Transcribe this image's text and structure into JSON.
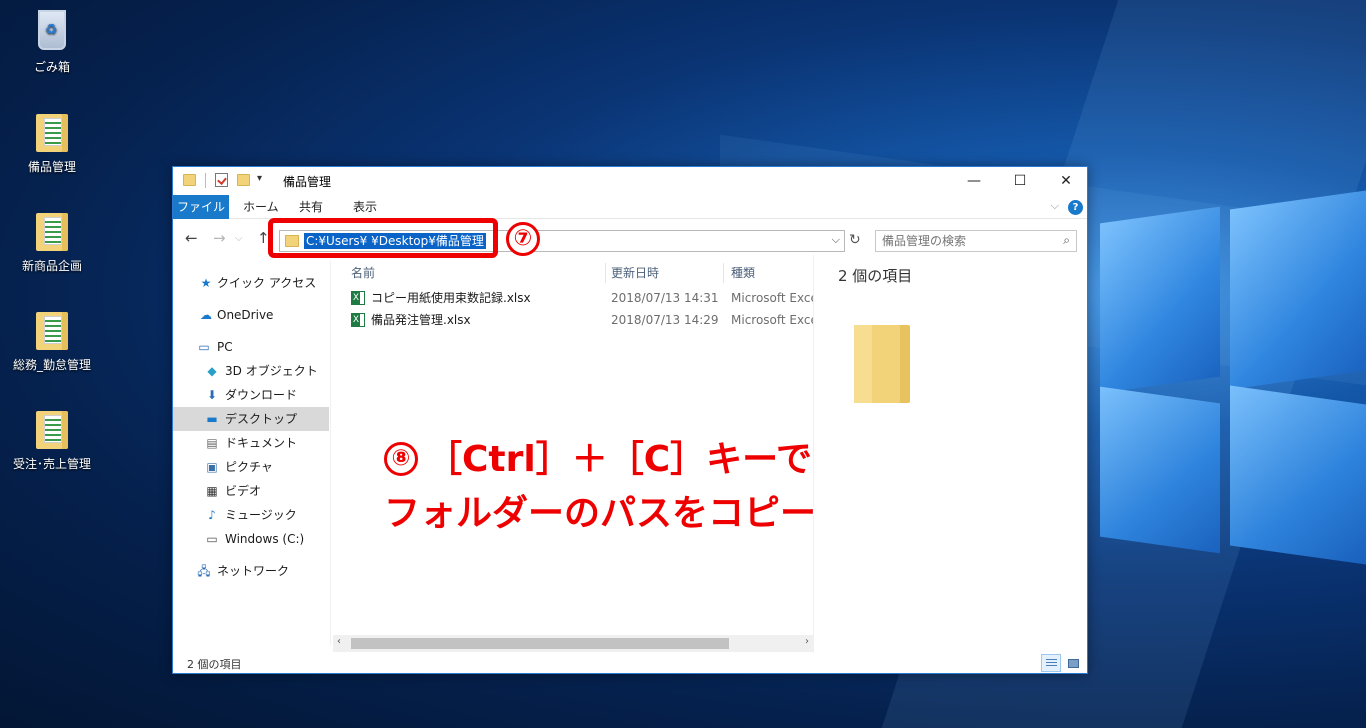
{
  "desktop": {
    "icons": [
      {
        "label": "ごみ箱",
        "icon": "recycle-bin-icon"
      },
      {
        "label": "備品管理",
        "icon": "folder-icon"
      },
      {
        "label": "新商品企画",
        "icon": "folder-icon"
      },
      {
        "label": "総務_勤怠管理",
        "icon": "folder-icon"
      },
      {
        "label": "受注･売上管理",
        "icon": "folder-icon"
      }
    ]
  },
  "window": {
    "title": "備品管理",
    "controls": {
      "minimize": "—",
      "maximize": "☐",
      "close": "✕"
    },
    "ribbon_tabs": [
      "ファイル",
      "ホーム",
      "共有",
      "表示"
    ],
    "help": "?",
    "address": {
      "path": "C:¥Users¥        ¥Desktop¥備品管理",
      "dropdown": "⌵"
    },
    "search_placeholder": "備品管理の検索",
    "nav_items": [
      {
        "label": "クイック アクセス",
        "icon": "star-icon"
      },
      {
        "label": "OneDrive",
        "icon": "cloud-icon"
      },
      {
        "label": "PC",
        "icon": "pc-icon"
      },
      {
        "label": "3D オブジェクト",
        "icon": "cube-icon"
      },
      {
        "label": "ダウンロード",
        "icon": "download-icon"
      },
      {
        "label": "デスクトップ",
        "icon": "desktop-icon",
        "selected": true
      },
      {
        "label": "ドキュメント",
        "icon": "document-icon"
      },
      {
        "label": "ピクチャ",
        "icon": "picture-icon"
      },
      {
        "label": "ビデオ",
        "icon": "video-icon"
      },
      {
        "label": "ミュージック",
        "icon": "music-icon"
      },
      {
        "label": "Windows (C:)",
        "icon": "drive-icon"
      },
      {
        "label": "ネットワーク",
        "icon": "network-icon"
      }
    ],
    "columns": [
      "名前",
      "更新日時",
      "種類"
    ],
    "files": [
      {
        "name": "コピー用紙使用束数記録.xlsx",
        "modified": "2018/07/13 14:31",
        "type": "Microsoft Excel"
      },
      {
        "name": "備品発注管理.xlsx",
        "modified": "2018/07/13 14:29",
        "type": "Microsoft Excel"
      }
    ],
    "preview_count": "2 個の項目",
    "status": "2 個の項目"
  },
  "annotations": {
    "step7_number": "⑦",
    "step8_number": "⑧",
    "step8_line1": "［Ctrl］＋［C］キーで",
    "step8_line2": "フォルダーのパスをコピー"
  },
  "colors": {
    "accent": "#1979ca",
    "selection": "#0a64c8",
    "annotation": "#ee0000"
  }
}
